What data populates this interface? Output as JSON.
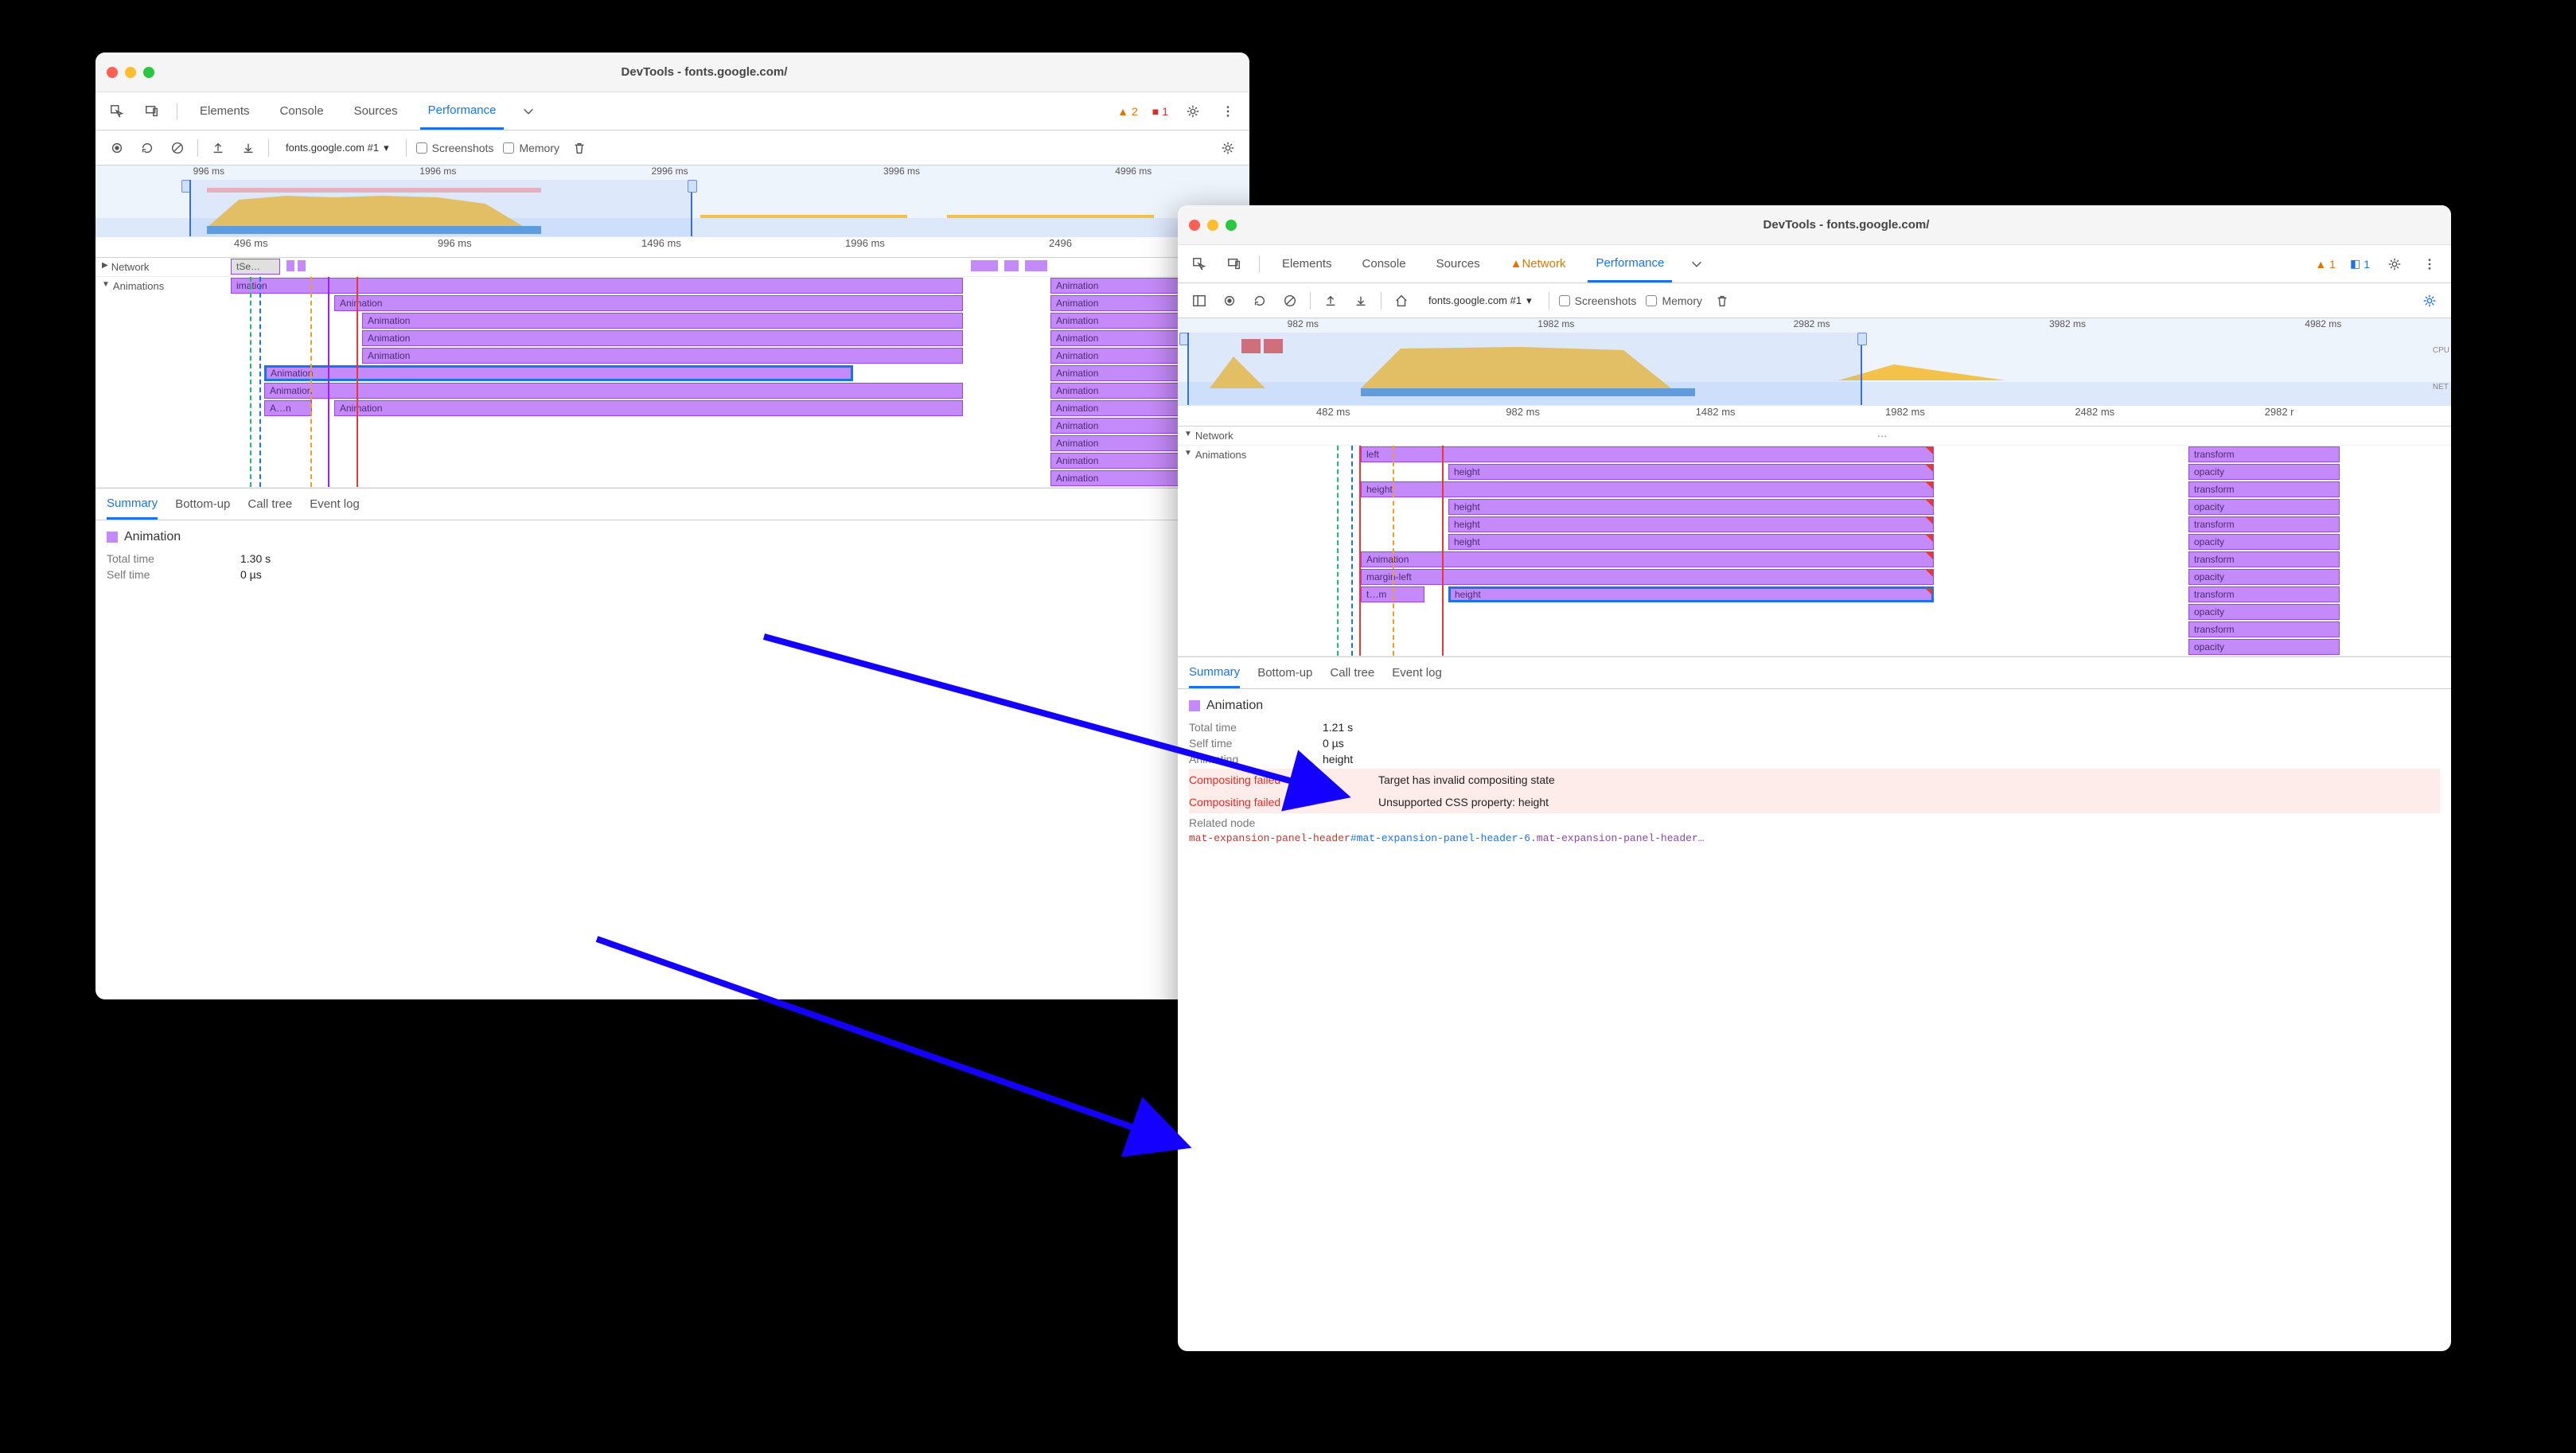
{
  "window1": {
    "title": "DevTools - fonts.google.com/",
    "tabs": {
      "elements": "Elements",
      "console": "Console",
      "sources": "Sources",
      "performance": "Performance",
      "warn_badge": "2",
      "err_badge": "1"
    },
    "toolbar": {
      "target": "fonts.google.com #1",
      "screenshots": "Screenshots",
      "memory": "Memory"
    },
    "overview_ticks": [
      "996 ms",
      "1996 ms",
      "2996 ms",
      "3996 ms",
      "4996 ms"
    ],
    "ruler": [
      "496 ms",
      "996 ms",
      "1496 ms",
      "1996 ms",
      "2496"
    ],
    "network_label": "Network",
    "network_snip": "tSe…",
    "animations_label": "Animations",
    "anim_head_text": "imation",
    "ev_generic": "Animation",
    "ev_trunc": "A…n",
    "detail_tabs": {
      "summary": "Summary",
      "bottomup": "Bottom-up",
      "calltree": "Call tree",
      "eventlog": "Event log"
    },
    "detail": {
      "title": "Animation",
      "total_k": "Total time",
      "total_v": "1.30 s",
      "self_k": "Self time",
      "self_v": "0 µs"
    }
  },
  "window2": {
    "title": "DevTools - fonts.google.com/",
    "tabs": {
      "elements": "Elements",
      "console": "Console",
      "sources": "Sources",
      "network": "Network",
      "performance": "Performance",
      "warn_badge": "1",
      "info_badge": "1"
    },
    "toolbar": {
      "target": "fonts.google.com #1",
      "screenshots": "Screenshots",
      "memory": "Memory"
    },
    "overview_ticks": [
      "982 ms",
      "1982 ms",
      "2982 ms",
      "3982 ms",
      "4982 ms"
    ],
    "overview_side": [
      "CPU",
      "NET"
    ],
    "ruler": [
      "482 ms",
      "982 ms",
      "1482 ms",
      "1982 ms",
      "2482 ms",
      "2982 r"
    ],
    "network_label": "Network",
    "animations_label": "Animations",
    "left_events": [
      "left",
      "height",
      "height",
      "height",
      "height",
      "height",
      "Animation",
      "margin-left",
      "t…m",
      "height"
    ],
    "right_events": [
      "transform",
      "opacity",
      "transform",
      "opacity",
      "transform",
      "opacity",
      "transform",
      "opacity",
      "transform",
      "opacity",
      "transform",
      "opacity"
    ],
    "detail_tabs": {
      "summary": "Summary",
      "bottomup": "Bottom-up",
      "calltree": "Call tree",
      "eventlog": "Event log"
    },
    "detail": {
      "title": "Animation",
      "total_k": "Total time",
      "total_v": "1.21 s",
      "self_k": "Self time",
      "self_v": "0 µs",
      "animating_k": "Animating",
      "animating_v": "height",
      "cf_k": "Compositing failed",
      "cf_v1": "Target has invalid compositing state",
      "cf_v2": "Unsupported CSS property: height",
      "related_k": "Related node",
      "node_tag": "mat-expansion-panel-header",
      "node_id": "#mat-expansion-panel-header-6",
      "node_cls": ".mat-expansion-panel-header…"
    }
  }
}
